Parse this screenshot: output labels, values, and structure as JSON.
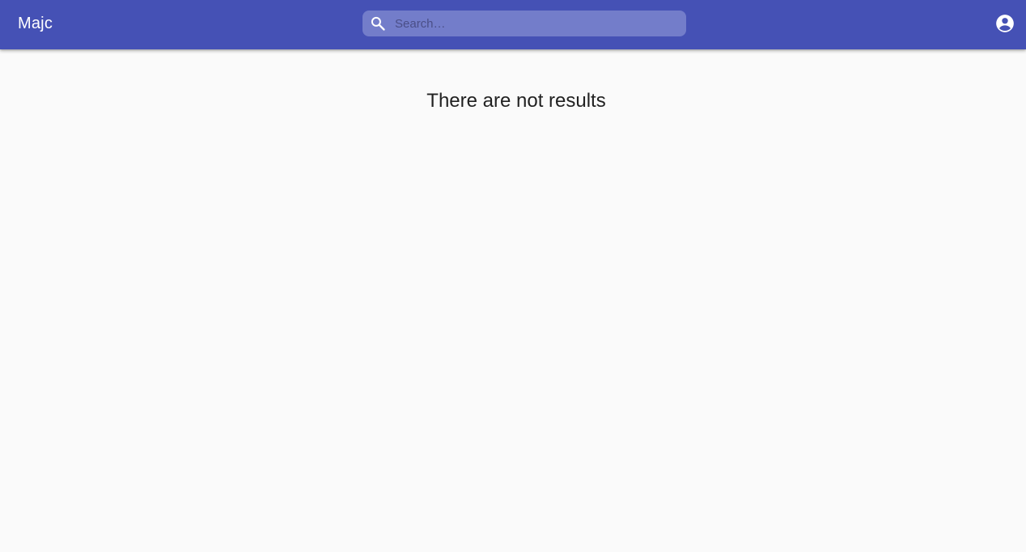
{
  "app": {
    "title": "Majc"
  },
  "search": {
    "placeholder": "Search…",
    "value": "",
    "icon": "search-icon"
  },
  "account": {
    "icon": "account-circle-icon"
  },
  "main": {
    "empty_message": "There are not results"
  },
  "colors": {
    "appbar": "#4551b5",
    "search_bg": "#737dca",
    "page_bg": "#fafafa",
    "text": "#212121"
  }
}
